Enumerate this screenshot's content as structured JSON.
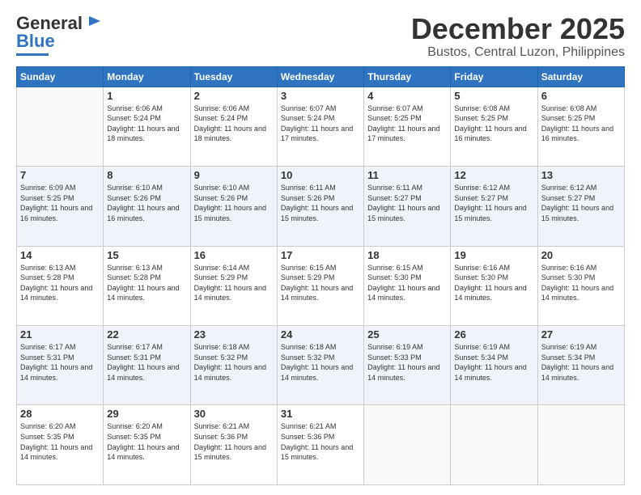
{
  "logo": {
    "general": "General",
    "blue": "Blue"
  },
  "title": {
    "month": "December 2025",
    "location": "Bustos, Central Luzon, Philippines"
  },
  "headers": [
    "Sunday",
    "Monday",
    "Tuesday",
    "Wednesday",
    "Thursday",
    "Friday",
    "Saturday"
  ],
  "weeks": [
    [
      {
        "day": "",
        "sunrise": "",
        "sunset": "",
        "daylight": ""
      },
      {
        "day": "1",
        "sunrise": "6:06 AM",
        "sunset": "5:24 PM",
        "daylight": "11 hours and 18 minutes."
      },
      {
        "day": "2",
        "sunrise": "6:06 AM",
        "sunset": "5:24 PM",
        "daylight": "11 hours and 18 minutes."
      },
      {
        "day": "3",
        "sunrise": "6:07 AM",
        "sunset": "5:24 PM",
        "daylight": "11 hours and 17 minutes."
      },
      {
        "day": "4",
        "sunrise": "6:07 AM",
        "sunset": "5:25 PM",
        "daylight": "11 hours and 17 minutes."
      },
      {
        "day": "5",
        "sunrise": "6:08 AM",
        "sunset": "5:25 PM",
        "daylight": "11 hours and 16 minutes."
      },
      {
        "day": "6",
        "sunrise": "6:08 AM",
        "sunset": "5:25 PM",
        "daylight": "11 hours and 16 minutes."
      }
    ],
    [
      {
        "day": "7",
        "sunrise": "6:09 AM",
        "sunset": "5:25 PM",
        "daylight": "11 hours and 16 minutes."
      },
      {
        "day": "8",
        "sunrise": "6:10 AM",
        "sunset": "5:26 PM",
        "daylight": "11 hours and 16 minutes."
      },
      {
        "day": "9",
        "sunrise": "6:10 AM",
        "sunset": "5:26 PM",
        "daylight": "11 hours and 15 minutes."
      },
      {
        "day": "10",
        "sunrise": "6:11 AM",
        "sunset": "5:26 PM",
        "daylight": "11 hours and 15 minutes."
      },
      {
        "day": "11",
        "sunrise": "6:11 AM",
        "sunset": "5:27 PM",
        "daylight": "11 hours and 15 minutes."
      },
      {
        "day": "12",
        "sunrise": "6:12 AM",
        "sunset": "5:27 PM",
        "daylight": "11 hours and 15 minutes."
      },
      {
        "day": "13",
        "sunrise": "6:12 AM",
        "sunset": "5:27 PM",
        "daylight": "11 hours and 15 minutes."
      }
    ],
    [
      {
        "day": "14",
        "sunrise": "6:13 AM",
        "sunset": "5:28 PM",
        "daylight": "11 hours and 14 minutes."
      },
      {
        "day": "15",
        "sunrise": "6:13 AM",
        "sunset": "5:28 PM",
        "daylight": "11 hours and 14 minutes."
      },
      {
        "day": "16",
        "sunrise": "6:14 AM",
        "sunset": "5:29 PM",
        "daylight": "11 hours and 14 minutes."
      },
      {
        "day": "17",
        "sunrise": "6:15 AM",
        "sunset": "5:29 PM",
        "daylight": "11 hours and 14 minutes."
      },
      {
        "day": "18",
        "sunrise": "6:15 AM",
        "sunset": "5:30 PM",
        "daylight": "11 hours and 14 minutes."
      },
      {
        "day": "19",
        "sunrise": "6:16 AM",
        "sunset": "5:30 PM",
        "daylight": "11 hours and 14 minutes."
      },
      {
        "day": "20",
        "sunrise": "6:16 AM",
        "sunset": "5:30 PM",
        "daylight": "11 hours and 14 minutes."
      }
    ],
    [
      {
        "day": "21",
        "sunrise": "6:17 AM",
        "sunset": "5:31 PM",
        "daylight": "11 hours and 14 minutes."
      },
      {
        "day": "22",
        "sunrise": "6:17 AM",
        "sunset": "5:31 PM",
        "daylight": "11 hours and 14 minutes."
      },
      {
        "day": "23",
        "sunrise": "6:18 AM",
        "sunset": "5:32 PM",
        "daylight": "11 hours and 14 minutes."
      },
      {
        "day": "24",
        "sunrise": "6:18 AM",
        "sunset": "5:32 PM",
        "daylight": "11 hours and 14 minutes."
      },
      {
        "day": "25",
        "sunrise": "6:19 AM",
        "sunset": "5:33 PM",
        "daylight": "11 hours and 14 minutes."
      },
      {
        "day": "26",
        "sunrise": "6:19 AM",
        "sunset": "5:34 PM",
        "daylight": "11 hours and 14 minutes."
      },
      {
        "day": "27",
        "sunrise": "6:19 AM",
        "sunset": "5:34 PM",
        "daylight": "11 hours and 14 minutes."
      }
    ],
    [
      {
        "day": "28",
        "sunrise": "6:20 AM",
        "sunset": "5:35 PM",
        "daylight": "11 hours and 14 minutes."
      },
      {
        "day": "29",
        "sunrise": "6:20 AM",
        "sunset": "5:35 PM",
        "daylight": "11 hours and 14 minutes."
      },
      {
        "day": "30",
        "sunrise": "6:21 AM",
        "sunset": "5:36 PM",
        "daylight": "11 hours and 15 minutes."
      },
      {
        "day": "31",
        "sunrise": "6:21 AM",
        "sunset": "5:36 PM",
        "daylight": "11 hours and 15 minutes."
      },
      {
        "day": "",
        "sunrise": "",
        "sunset": "",
        "daylight": ""
      },
      {
        "day": "",
        "sunrise": "",
        "sunset": "",
        "daylight": ""
      },
      {
        "day": "",
        "sunrise": "",
        "sunset": "",
        "daylight": ""
      }
    ]
  ]
}
